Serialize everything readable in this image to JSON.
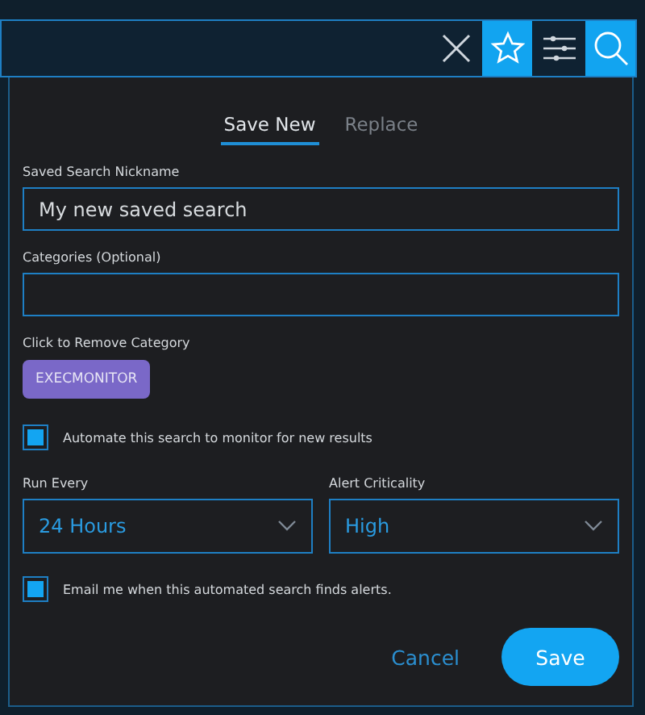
{
  "toolbar": {
    "buttons": [
      {
        "kind": "clear",
        "selected": false
      },
      {
        "kind": "star",
        "selected": true
      },
      {
        "kind": "filters",
        "selected": false
      },
      {
        "kind": "search",
        "selected": true
      }
    ]
  },
  "tabs": [
    {
      "label": "Save New",
      "selected": true
    },
    {
      "label": "Replace",
      "selected": false
    }
  ],
  "nickname": {
    "label": "Saved Search Nickname",
    "value": "My new saved search"
  },
  "categories": {
    "label": "Categories (Optional)"
  },
  "category_chips": {
    "label": "Click to Remove Category",
    "chips": [
      {
        "label": "EXECMONITOR",
        "color": "#7a68c8"
      }
    ]
  },
  "automate": {
    "label": "Automate this search to monitor for new results",
    "checked": true
  },
  "selects": [
    {
      "label": "Run Every",
      "value": "24 Hours"
    },
    {
      "label": "Alert Criticality",
      "value": "High"
    }
  ],
  "email": {
    "label": "Email me when this automated search finds alerts.",
    "checked": true
  },
  "actions": {
    "cancel": "Cancel",
    "save": "Save"
  }
}
